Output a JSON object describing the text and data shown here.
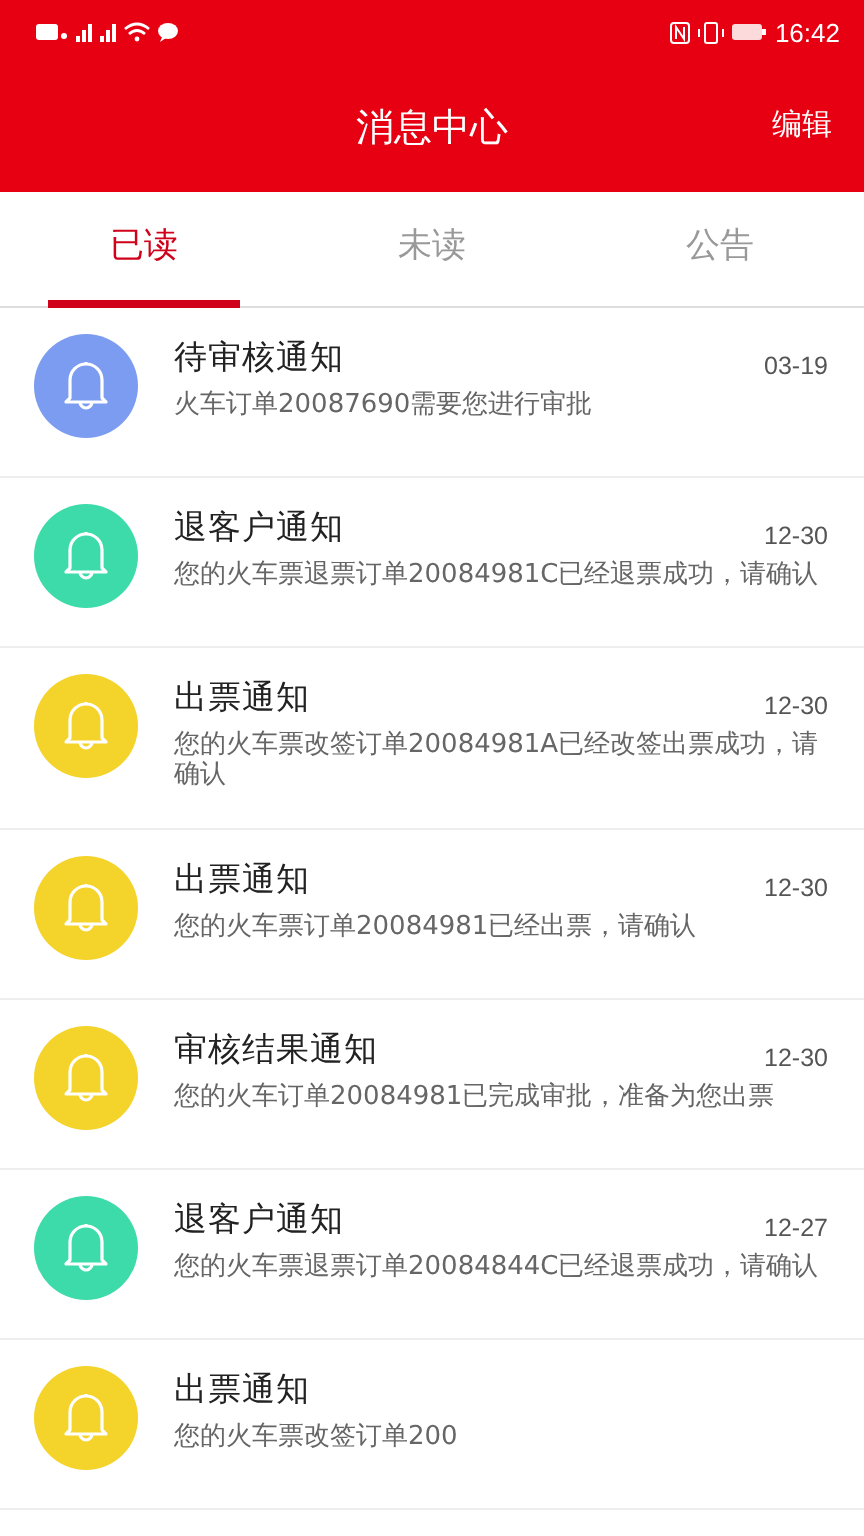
{
  "status_bar": {
    "time": "16:42"
  },
  "header": {
    "title": "消息中心",
    "action": "编辑"
  },
  "tabs": [
    {
      "label": "已读",
      "selected": true
    },
    {
      "label": "未读",
      "selected": false
    },
    {
      "label": "公告",
      "selected": false
    }
  ],
  "messages": [
    {
      "title": "待审核通知",
      "date": "03-19",
      "text": "火车订单20087690需要您进行审批",
      "color": "#7b9cf0"
    },
    {
      "title": "退客户通知",
      "date": "12-30",
      "text": "您的火车票退票订单20084981C已经退票成功，请确认",
      "color": "#3ddba9"
    },
    {
      "title": "出票通知",
      "date": "12-30",
      "text": "您的火车票改签订单20084981A已经改签出票成功，请确认",
      "color": "#f4d32b"
    },
    {
      "title": "出票通知",
      "date": "12-30",
      "text": "您的火车票订单20084981已经出票，请确认",
      "color": "#f4d32b"
    },
    {
      "title": "审核结果通知",
      "date": "12-30",
      "text": "您的火车订单20084981已完成审批，准备为您出票",
      "color": "#f4d32b"
    },
    {
      "title": "退客户通知",
      "date": "12-27",
      "text": "您的火车票退票订单20084844C已经退票成功，请确认",
      "color": "#3ddba9"
    },
    {
      "title": "出票通知",
      "text": "您的火车票改签订单200",
      "color": "#f4d32b"
    }
  ]
}
